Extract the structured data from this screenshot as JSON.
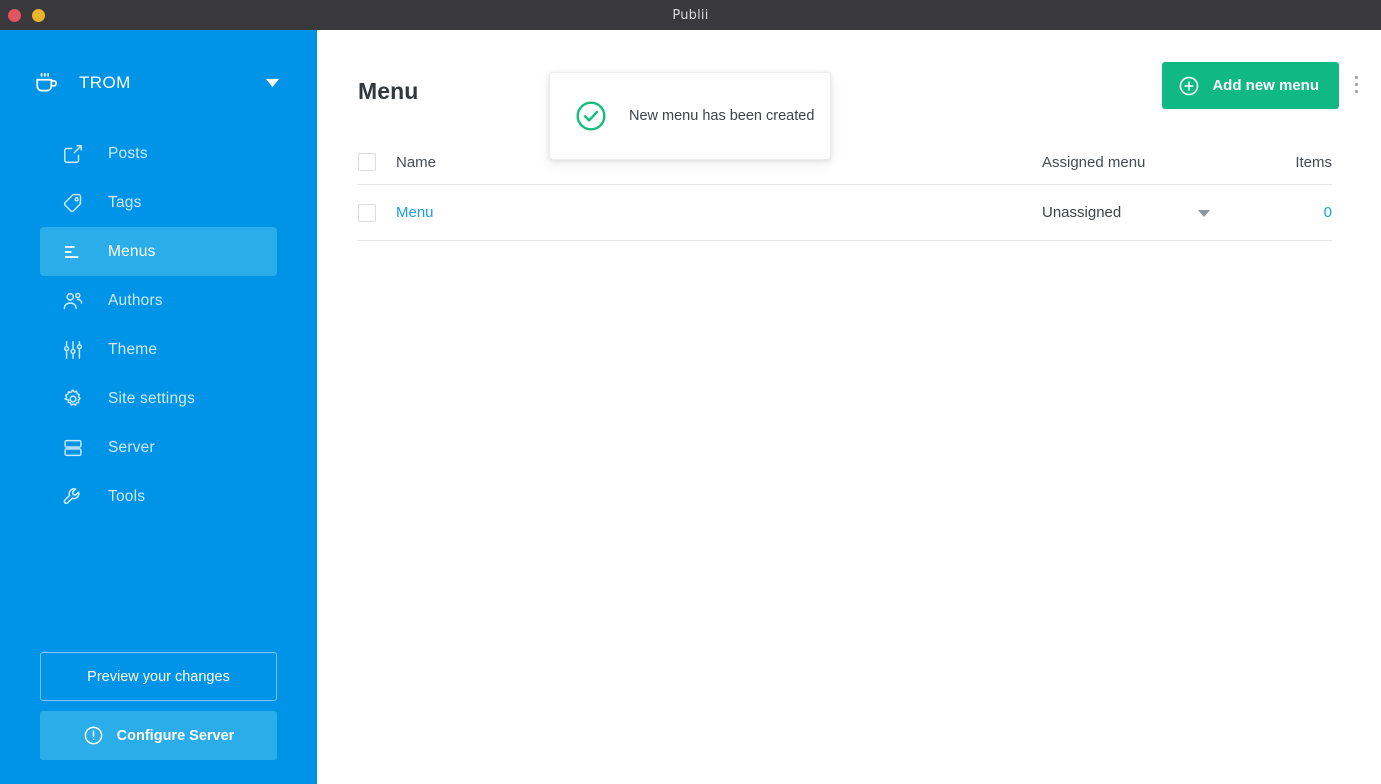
{
  "window": {
    "title": "Publii",
    "controls": [
      {
        "name": "close",
        "color": "#e15561"
      },
      {
        "name": "minimize",
        "color": "#e9b429"
      }
    ]
  },
  "sidebar": {
    "site": {
      "name": "TROM",
      "logo_icon": "coffee-cup-icon",
      "caret_icon": "chevron-down-icon"
    },
    "items": [
      {
        "label": "Posts",
        "icon": "edit-square-icon",
        "active": false
      },
      {
        "label": "Tags",
        "icon": "tag-icon",
        "active": false
      },
      {
        "label": "Menus",
        "icon": "menu-lines-icon",
        "active": true
      },
      {
        "label": "Authors",
        "icon": "users-icon",
        "active": false
      },
      {
        "label": "Theme",
        "icon": "sliders-icon",
        "active": false
      },
      {
        "label": "Site settings",
        "icon": "gear-icon",
        "active": false
      },
      {
        "label": "Server",
        "icon": "server-icon",
        "active": false
      },
      {
        "label": "Tools",
        "icon": "wrench-icon",
        "active": false
      }
    ],
    "preview_button": {
      "label": "Preview your changes"
    },
    "configure_button": {
      "label": "Configure Server",
      "icon": "alert-circle-icon"
    }
  },
  "main": {
    "page_title": "Menu",
    "kebab_icon": "more-vertical-icon",
    "add_button": {
      "label": "Add new menu",
      "icon": "plus-circle-icon"
    },
    "toast": {
      "message": "New menu has been created",
      "icon": "check-circle-icon"
    },
    "table": {
      "columns": [
        "Name",
        "Assigned menu",
        "Items"
      ],
      "rows": [
        {
          "name": "Menu",
          "assigned": "Unassigned",
          "assigned_caret": "caret-down-icon",
          "items": "0"
        }
      ]
    }
  },
  "colors": {
    "sidebar": "#0094e8",
    "sidebar_active": "#2aade9",
    "accent_green": "#10b981",
    "link_blue": "#1a9fe0",
    "titlebar": "#38383d",
    "toast_check": "#13bf7f"
  }
}
